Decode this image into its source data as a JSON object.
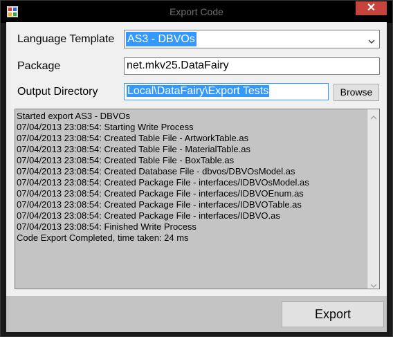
{
  "window": {
    "title": "Export Code",
    "close_glyph": "✕"
  },
  "form": {
    "language_template_label": "Language Template",
    "language_template_value": "AS3 - DBVOs",
    "package_label": "Package",
    "package_value": "net.mkv25.DataFairy",
    "output_directory_label": "Output Directory",
    "output_directory_value": "Local\\DataFairy\\Export Tests",
    "browse_label": "Browse"
  },
  "log": {
    "lines": [
      "Started export  AS3 - DBVOs",
      "07/04/2013 23:08:54: Starting Write Process",
      "07/04/2013 23:08:54: Created Table File - ArtworkTable.as",
      "07/04/2013 23:08:54: Created Table File - MaterialTable.as",
      "07/04/2013 23:08:54: Created Table File - BoxTable.as",
      "07/04/2013 23:08:54: Created Database File - dbvos/DBVOsModel.as",
      "07/04/2013 23:08:54: Created Package File - interfaces/IDBVOsModel.as",
      "07/04/2013 23:08:54: Created Package File - interfaces/IDBVOEnum.as",
      "07/04/2013 23:08:54: Created Package File - interfaces/IDBVOTable.as",
      "07/04/2013 23:08:54: Created Package File - interfaces/IDBVO.as",
      "07/04/2013 23:08:54: Finished Write Process",
      "Code Export Completed, time taken: 24 ms"
    ]
  },
  "actions": {
    "export_label": "Export"
  },
  "colors": {
    "selection": "#3399ff",
    "close_button": "#c7443c",
    "log_background": "#c4c4c4"
  }
}
